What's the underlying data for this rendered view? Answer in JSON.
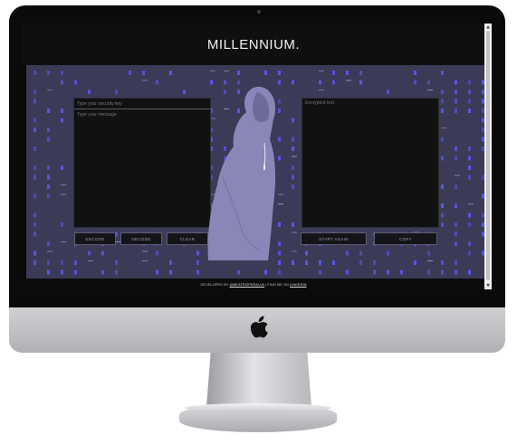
{
  "app": {
    "title": "MILLENNIUM.",
    "key_placeholder": "Type your security key",
    "message_placeholder": "Type your message",
    "output_placeholder": "Encrypted text",
    "buttons": {
      "encode": "ENCODE",
      "decode": "DECODE",
      "clear": "CLEAR",
      "start_again": "START AGAIN",
      "copy": "COPY"
    },
    "footer": {
      "prefix": "DEVELOPED BY",
      "author": "@BEATRIZPERALVA",
      "middle": "| FIND ME ON",
      "link": "LINKEDIN"
    }
  },
  "colors": {
    "background": "#3b3a57",
    "glyph": "#5c56f2",
    "figure": "#8a86b8",
    "panel": "#111111"
  },
  "icons": {
    "device_logo": "apple-logo-icon",
    "figure": "hooded-figure-illustration"
  }
}
